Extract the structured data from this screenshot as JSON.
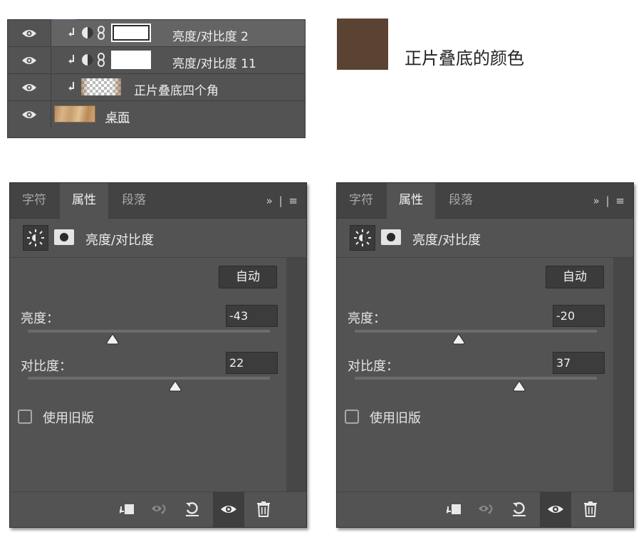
{
  "layers": {
    "rows": [
      {
        "name": "亮度/对比度 2"
      },
      {
        "name": "亮度/对比度 11"
      },
      {
        "name": "正片叠底四个角"
      },
      {
        "name": "桌面"
      }
    ]
  },
  "swatch": {
    "color": "#5b4334",
    "label": "正片叠底的颜色"
  },
  "panels": [
    {
      "tabs": [
        "字符",
        "属性",
        "段落"
      ],
      "active_tab": "属性",
      "menu": "»  |  ≡",
      "title": "亮度/对比度",
      "auto_label": "自动",
      "brightness": {
        "label": "亮度：",
        "value": "-43",
        "slider_fraction": 0.35
      },
      "contrast": {
        "label": "对比度：",
        "value": "22",
        "slider_fraction": 0.61
      },
      "legacy_label": "使用旧版"
    },
    {
      "tabs": [
        "字符",
        "属性",
        "段落"
      ],
      "active_tab": "属性",
      "menu": "»  |  ≡",
      "title": "亮度/对比度",
      "auto_label": "自动",
      "brightness": {
        "label": "亮度：",
        "value": "-20",
        "slider_fraction": 0.43
      },
      "contrast": {
        "label": "对比度：",
        "value": "37",
        "slider_fraction": 0.68
      },
      "legacy_label": "使用旧版"
    }
  ],
  "icons": {
    "eye": "eye-icon",
    "clip": "clipping-arrow-icon",
    "adjust": "brightness-contrast-adjustment-icon",
    "link": "chain-link-icon",
    "sun": "sun-icon",
    "mask": "layer-mask-icon",
    "footer": [
      "clip-to-layer-icon",
      "view-previous-state-icon",
      "reset-icon",
      "visibility-eye-icon",
      "trash-icon"
    ]
  }
}
